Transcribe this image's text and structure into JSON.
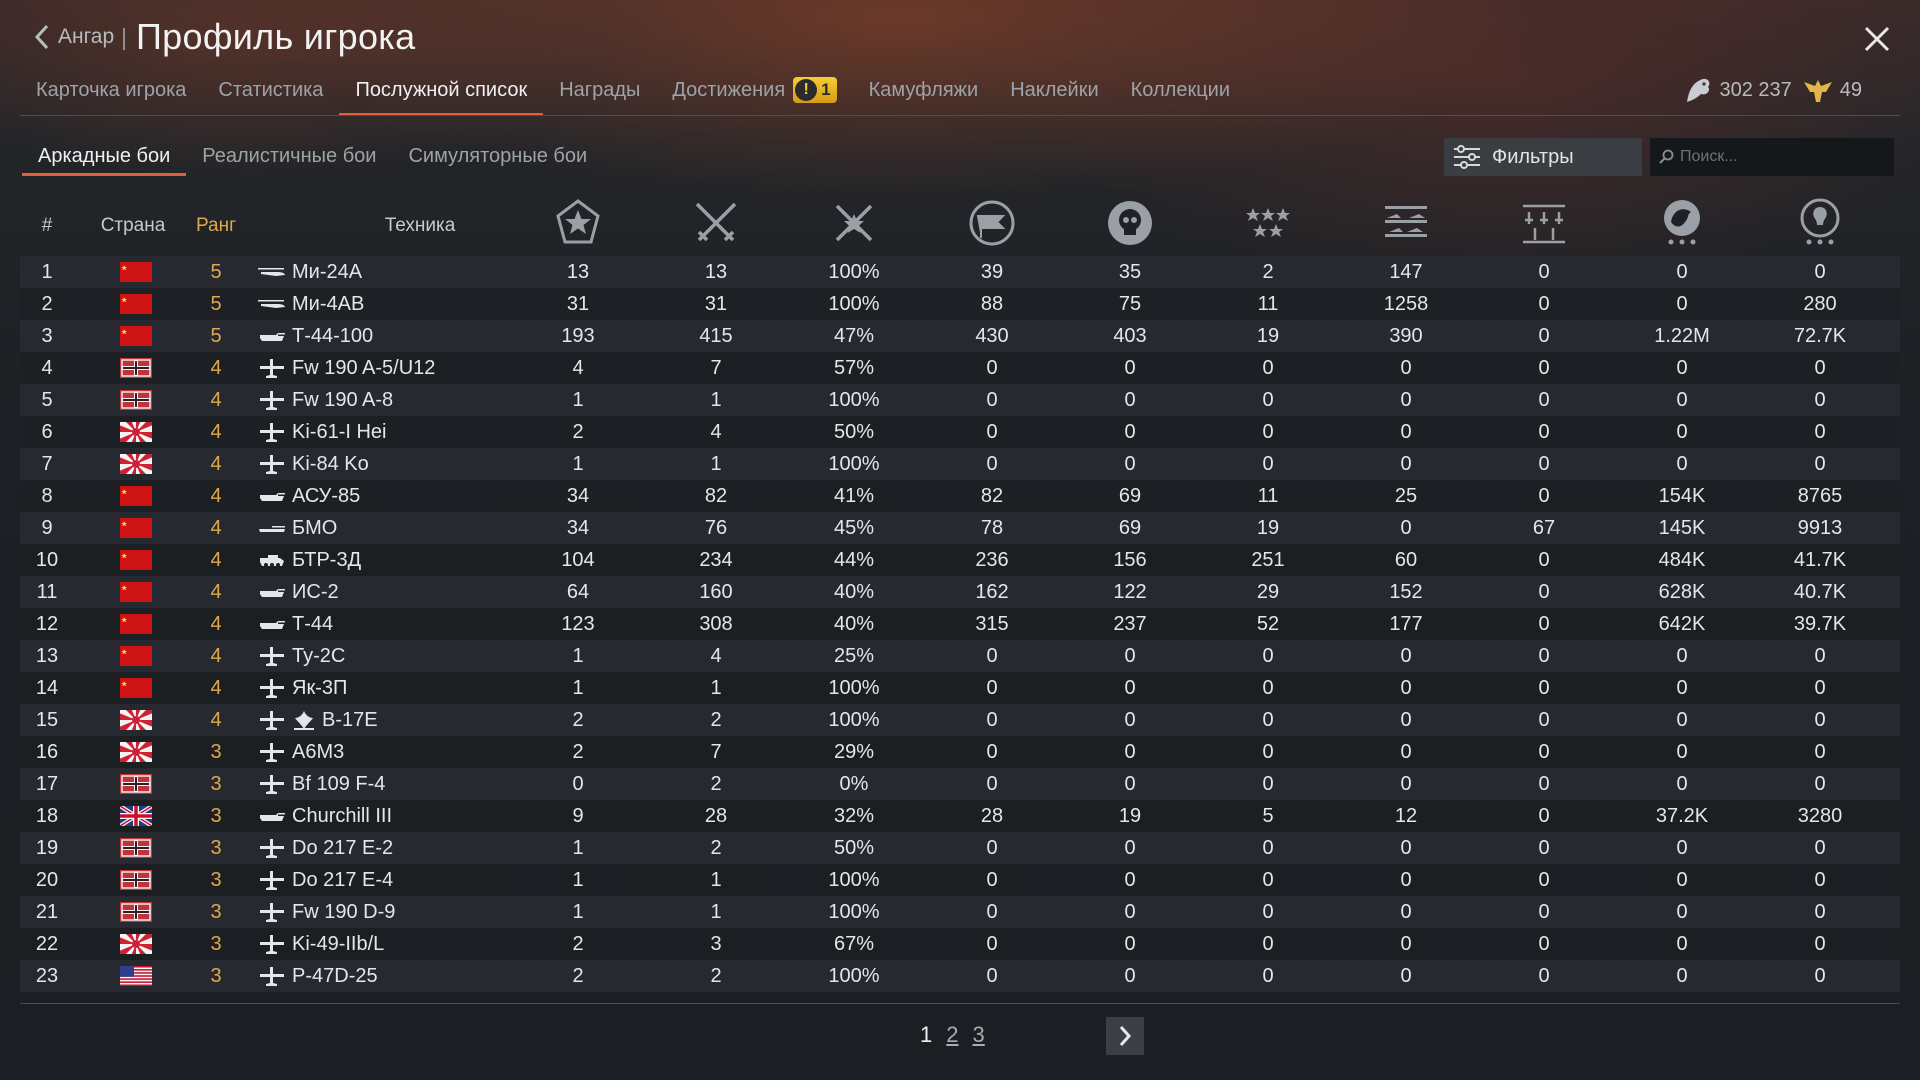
{
  "header": {
    "back_label": "Ангар",
    "title": "Профиль игрока"
  },
  "tabs": [
    {
      "label": "Карточка игрока"
    },
    {
      "label": "Статистика"
    },
    {
      "label": "Послужной список"
    },
    {
      "label": "Награды"
    },
    {
      "label": "Достижения",
      "badge": "1"
    },
    {
      "label": "Камуфляжи"
    },
    {
      "label": "Наклейки"
    },
    {
      "label": "Коллекции"
    }
  ],
  "active_tab": "Послужной список",
  "currency": {
    "silver_lions": "302 237",
    "golden_eagles": "49"
  },
  "mode_tabs": [
    {
      "label": "Аркадные бои"
    },
    {
      "label": "Реалистичные бои"
    },
    {
      "label": "Симуляторные бои"
    }
  ],
  "active_mode": "Аркадные бои",
  "filters_label": "Фильтры",
  "search": {
    "placeholder": "Поиск...",
    "value": ""
  },
  "columns": {
    "num": "#",
    "country": "Страна",
    "rank": "Ранг",
    "vehicle": "Техника",
    "stat_icons": [
      "star-badge-icon",
      "crossed-swords-icon",
      "victories-icon",
      "capture-flag-icon",
      "skull-icon",
      "stars-icon",
      "squadron-icon",
      "ground-icon",
      "lion-icon",
      "research-icon"
    ]
  },
  "colors": {
    "accent": "#e0603a",
    "rank": "#e0a84a"
  },
  "rows": [
    {
      "n": "1",
      "country": "ussr",
      "rank": "5",
      "type": "heli",
      "name": "Ми-24А",
      "s": [
        "13",
        "13",
        "100%",
        "39",
        "35",
        "2",
        "147",
        "0",
        "0",
        "0"
      ]
    },
    {
      "n": "2",
      "country": "ussr",
      "rank": "5",
      "type": "heli",
      "name": "Ми-4АВ",
      "s": [
        "31",
        "31",
        "100%",
        "88",
        "75",
        "11",
        "1258",
        "0",
        "0",
        "280"
      ]
    },
    {
      "n": "3",
      "country": "ussr",
      "rank": "5",
      "type": "tank",
      "name": "Т-44-100",
      "s": [
        "193",
        "415",
        "47%",
        "430",
        "403",
        "19",
        "390",
        "0",
        "1.22M",
        "72.7K"
      ]
    },
    {
      "n": "4",
      "country": "germany",
      "rank": "4",
      "type": "plane",
      "name": "Fw 190 A-5/U12",
      "s": [
        "4",
        "7",
        "57%",
        "0",
        "0",
        "0",
        "0",
        "0",
        "0",
        "0"
      ]
    },
    {
      "n": "5",
      "country": "germany",
      "rank": "4",
      "type": "plane",
      "name": "Fw 190 A-8",
      "s": [
        "1",
        "1",
        "100%",
        "0",
        "0",
        "0",
        "0",
        "0",
        "0",
        "0"
      ]
    },
    {
      "n": "6",
      "country": "japan",
      "rank": "4",
      "type": "plane",
      "name": "Ki-61-I Hei",
      "s": [
        "2",
        "4",
        "50%",
        "0",
        "0",
        "0",
        "0",
        "0",
        "0",
        "0"
      ]
    },
    {
      "n": "7",
      "country": "japan",
      "rank": "4",
      "type": "plane",
      "name": "Ki-84 Ko",
      "s": [
        "1",
        "1",
        "100%",
        "0",
        "0",
        "0",
        "0",
        "0",
        "0",
        "0"
      ]
    },
    {
      "n": "8",
      "country": "ussr",
      "rank": "4",
      "type": "tank",
      "name": "АСУ-85",
      "s": [
        "34",
        "82",
        "41%",
        "82",
        "69",
        "11",
        "25",
        "0",
        "154K",
        "8765"
      ]
    },
    {
      "n": "9",
      "country": "ussr",
      "rank": "4",
      "type": "spaa",
      "name": "БМО",
      "s": [
        "34",
        "76",
        "45%",
        "78",
        "69",
        "19",
        "0",
        "67",
        "145K",
        "9913"
      ]
    },
    {
      "n": "10",
      "country": "ussr",
      "rank": "4",
      "type": "ifv",
      "name": "БТР-3Д",
      "s": [
        "104",
        "234",
        "44%",
        "236",
        "156",
        "251",
        "60",
        "0",
        "484K",
        "41.7K"
      ]
    },
    {
      "n": "11",
      "country": "ussr",
      "rank": "4",
      "type": "tank",
      "name": "ИС-2",
      "s": [
        "64",
        "160",
        "40%",
        "162",
        "122",
        "29",
        "152",
        "0",
        "628K",
        "40.7K"
      ]
    },
    {
      "n": "12",
      "country": "ussr",
      "rank": "4",
      "type": "tank",
      "name": "Т-44",
      "s": [
        "123",
        "308",
        "40%",
        "315",
        "237",
        "52",
        "177",
        "0",
        "642K",
        "39.7K"
      ]
    },
    {
      "n": "13",
      "country": "ussr",
      "rank": "4",
      "type": "plane",
      "name": "Ту-2С",
      "s": [
        "1",
        "4",
        "25%",
        "0",
        "0",
        "0",
        "0",
        "0",
        "0",
        "0"
      ]
    },
    {
      "n": "14",
      "country": "ussr",
      "rank": "4",
      "type": "plane",
      "name": "Як-3П",
      "s": [
        "1",
        "1",
        "100%",
        "0",
        "0",
        "0",
        "0",
        "0",
        "0",
        "0"
      ]
    },
    {
      "n": "15",
      "country": "japan",
      "rank": "4",
      "type": "plane",
      "name": "B-17E",
      "prefix": "trophy",
      "s": [
        "2",
        "2",
        "100%",
        "0",
        "0",
        "0",
        "0",
        "0",
        "0",
        "0"
      ]
    },
    {
      "n": "16",
      "country": "japan",
      "rank": "3",
      "type": "plane",
      "name": "A6M3",
      "s": [
        "2",
        "7",
        "29%",
        "0",
        "0",
        "0",
        "0",
        "0",
        "0",
        "0"
      ]
    },
    {
      "n": "17",
      "country": "germany",
      "rank": "3",
      "type": "plane",
      "name": "Bf 109 F-4",
      "s": [
        "0",
        "2",
        "0%",
        "0",
        "0",
        "0",
        "0",
        "0",
        "0",
        "0"
      ]
    },
    {
      "n": "18",
      "country": "britain",
      "rank": "3",
      "type": "tank",
      "name": "Churchill III",
      "s": [
        "9",
        "28",
        "32%",
        "28",
        "19",
        "5",
        "12",
        "0",
        "37.2K",
        "3280"
      ]
    },
    {
      "n": "19",
      "country": "germany",
      "rank": "3",
      "type": "plane",
      "name": "Do 217 E-2",
      "s": [
        "1",
        "2",
        "50%",
        "0",
        "0",
        "0",
        "0",
        "0",
        "0",
        "0"
      ]
    },
    {
      "n": "20",
      "country": "germany",
      "rank": "3",
      "type": "plane",
      "name": "Do 217 E-4",
      "s": [
        "1",
        "1",
        "100%",
        "0",
        "0",
        "0",
        "0",
        "0",
        "0",
        "0"
      ]
    },
    {
      "n": "21",
      "country": "germany",
      "rank": "3",
      "type": "plane",
      "name": "Fw 190 D-9",
      "s": [
        "1",
        "1",
        "100%",
        "0",
        "0",
        "0",
        "0",
        "0",
        "0",
        "0"
      ]
    },
    {
      "n": "22",
      "country": "japan",
      "rank": "3",
      "type": "plane",
      "name": "Ki-49-IIb/L",
      "s": [
        "2",
        "3",
        "67%",
        "0",
        "0",
        "0",
        "0",
        "0",
        "0",
        "0"
      ]
    },
    {
      "n": "23",
      "country": "usa",
      "rank": "3",
      "type": "plane",
      "name": "P-47D-25",
      "s": [
        "2",
        "2",
        "100%",
        "0",
        "0",
        "0",
        "0",
        "0",
        "0",
        "0"
      ]
    }
  ],
  "pagination": {
    "pages": [
      "1",
      "2",
      "3"
    ],
    "current": "1"
  }
}
